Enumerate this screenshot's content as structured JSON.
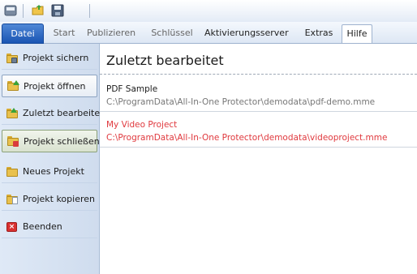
{
  "quick_access": {
    "icons": [
      "app-menu-icon",
      "open-folder-icon",
      "save-disk-icon"
    ]
  },
  "ribbon": {
    "tabs": [
      "Datei",
      "Start",
      "Publizieren",
      "Schlüssel",
      "Aktivierungsserver",
      "Extras",
      "Hilfe"
    ],
    "active_tab": "Datei",
    "file_tab_color": "#2a62c0"
  },
  "menu": {
    "items": [
      {
        "label": "Projekt sichern",
        "icon": "save-project-icon"
      },
      {
        "label": "Projekt öffnen",
        "icon": "open-project-icon"
      },
      {
        "label": "Zuletzt bearbeitet",
        "icon": "recent-icon"
      },
      {
        "label": "Projekt schließen",
        "icon": "close-project-icon"
      },
      {
        "label": "Neues Projekt",
        "icon": "new-project-icon"
      },
      {
        "label": "Projekt kopieren",
        "icon": "copy-project-icon"
      },
      {
        "label": "Beenden",
        "icon": "exit-icon"
      }
    ],
    "selected": "Projekt öffnen",
    "hovered": "Projekt schließen"
  },
  "content": {
    "heading": "Zuletzt bearbeitet",
    "recent": [
      {
        "title": "PDF Sample",
        "path": "C:\\ProgramData\\All-In-One Protector\\demodata\\pdf-demo.mme"
      },
      {
        "title": "My Video Project",
        "path": "C:\\ProgramData\\All-In-One Protector\\demodata\\videoproject.mme"
      }
    ],
    "highlight_color": "#e0393e"
  }
}
